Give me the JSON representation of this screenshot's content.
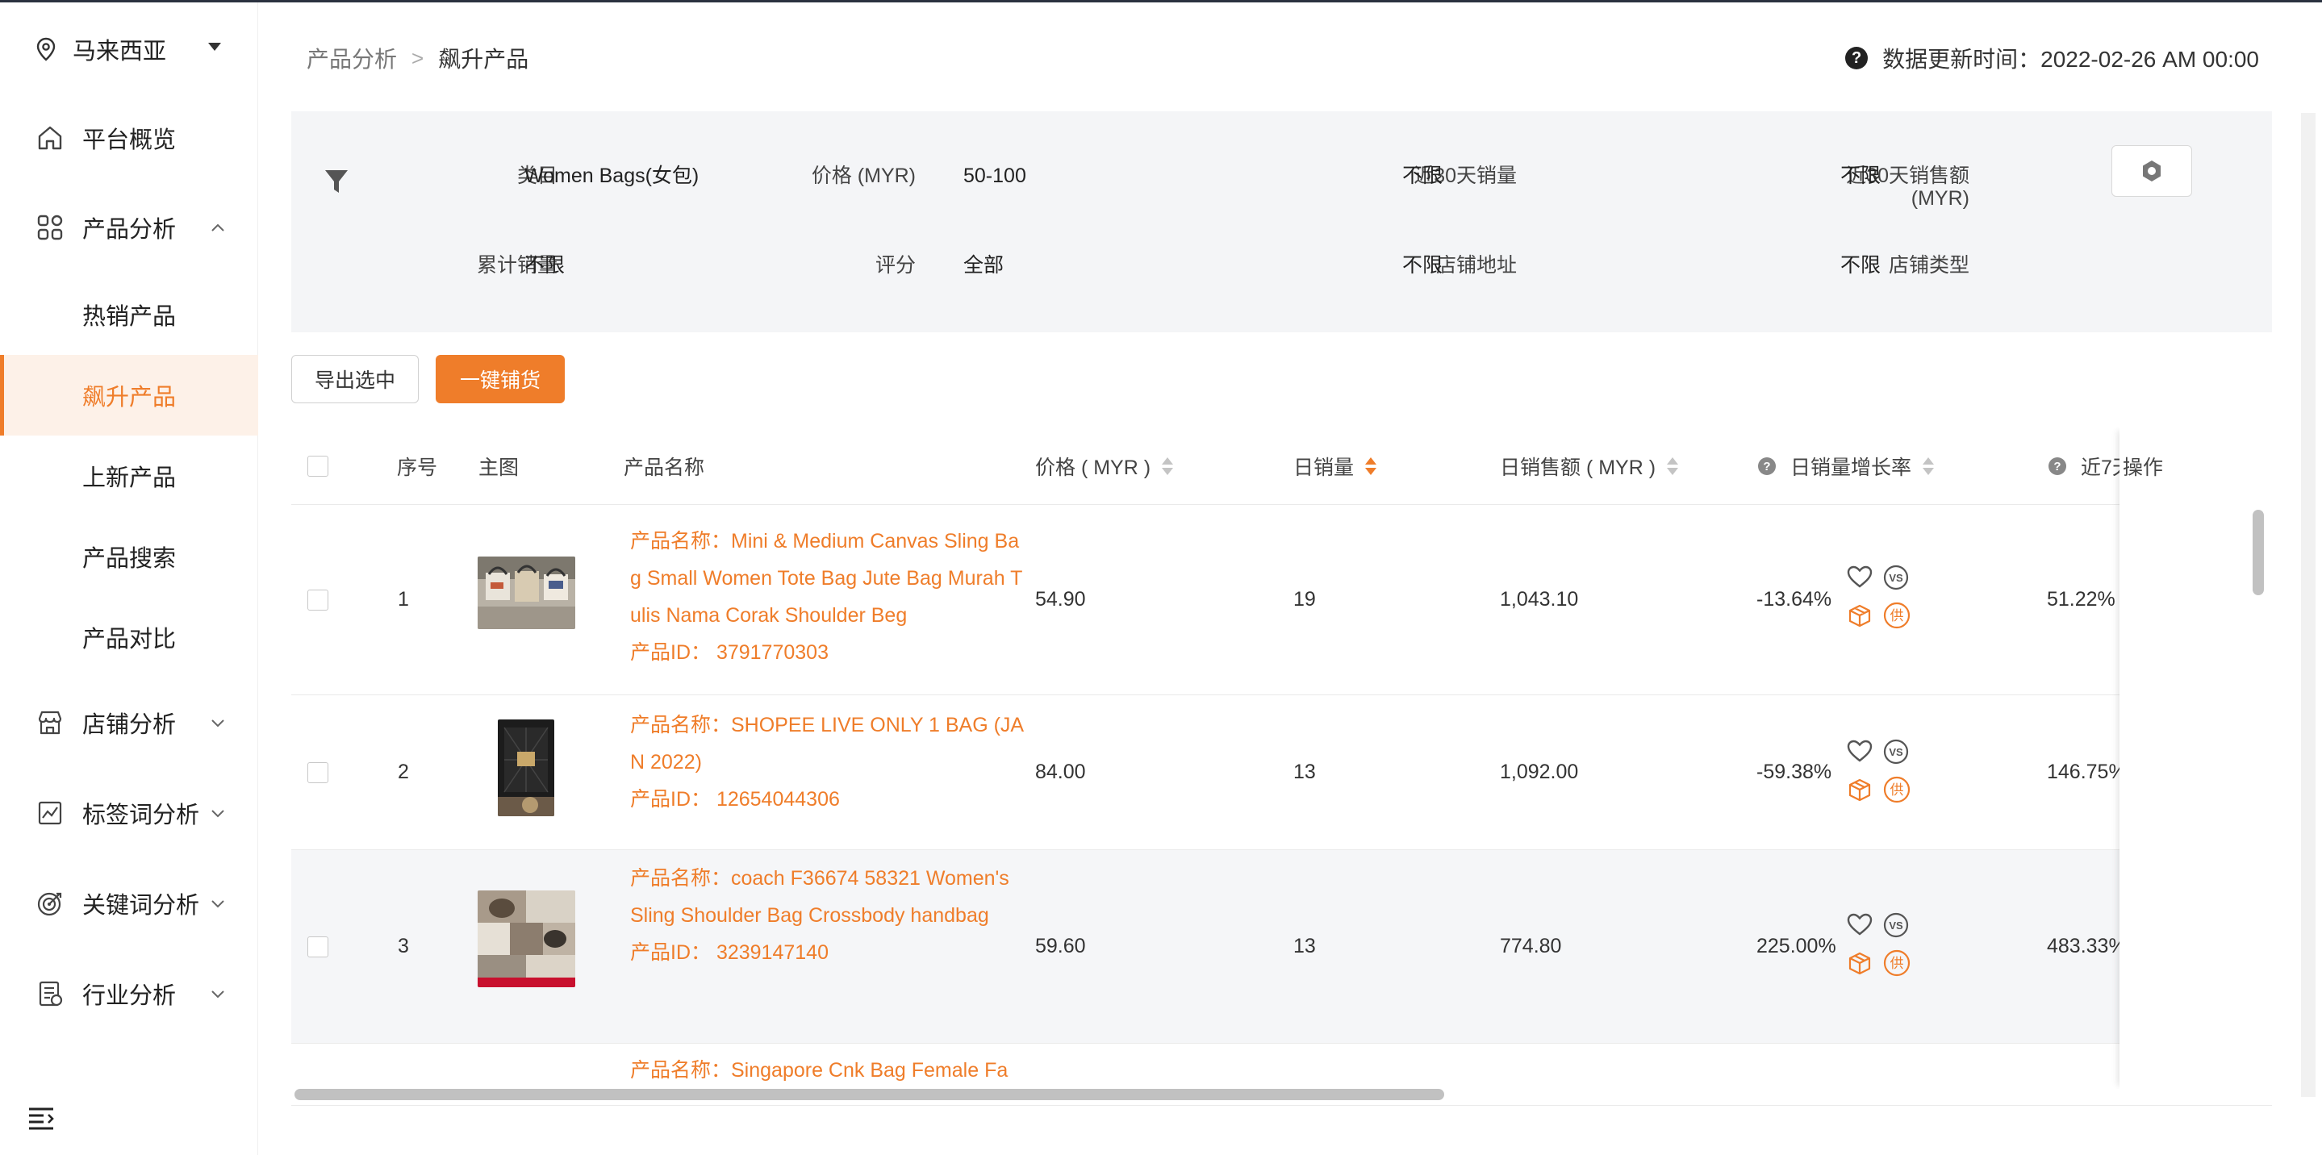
{
  "location": {
    "label": "马来西亚"
  },
  "sidebar": {
    "items": [
      {
        "label": "平台概览"
      },
      {
        "label": "产品分析"
      },
      {
        "label": "店铺分析"
      },
      {
        "label": "标签词分析"
      },
      {
        "label": "关键词分析"
      },
      {
        "label": "行业分析"
      }
    ],
    "sub_items": [
      {
        "label": "热销产品"
      },
      {
        "label": "飙升产品"
      },
      {
        "label": "上新产品"
      },
      {
        "label": "产品搜索"
      },
      {
        "label": "产品对比"
      }
    ]
  },
  "breadcrumb": {
    "parent": "产品分析",
    "separator": ">",
    "current": "飙升产品"
  },
  "update_time": {
    "label": "数据更新时间：2022-02-26 AM 00:00"
  },
  "filters": {
    "category": {
      "label": "类目",
      "value": "Women Bags(女包)"
    },
    "price": {
      "label": "价格 (MYR)",
      "value": "50-100"
    },
    "sales30": {
      "label": "近30天销量",
      "value": "不限"
    },
    "revenue30": {
      "label": "近30天销售额",
      "label2": "(MYR)",
      "value": "不限"
    },
    "total_sales": {
      "label": "累计销量",
      "value": "不限"
    },
    "rating": {
      "label": "评分",
      "value": "全部"
    },
    "shop_location": {
      "label": "店铺地址",
      "value": "不限"
    },
    "shop_type": {
      "label": "店铺类型",
      "value": "不限"
    }
  },
  "actions": {
    "export_label": "导出选中",
    "stock_label": "一键铺货"
  },
  "table": {
    "headers": {
      "index": "序号",
      "image": "主图",
      "name": "产品名称",
      "price": "价格 ( MYR )",
      "daily_sales": "日销量",
      "daily_revenue": "日销售额 ( MYR )",
      "growth": "日销量增长率",
      "growth7": "近7天",
      "ops": "操作"
    },
    "rows": [
      {
        "index": "1",
        "name_line": "产品名称：Mini & Medium Canvas Sling Bag Small Women Tote Bag Jute Bag Murah Tulis Nama Corak Shoulder Beg",
        "id_line": "产品ID：  3791770303",
        "price": "54.90",
        "daily_sales": "19",
        "daily_revenue": "1,043.10",
        "growth": "-13.64%",
        "growth7": "51.22%"
      },
      {
        "index": "2",
        "name_line": "产品名称：SHOPEE LIVE ONLY 1 BAG (JAN 2022)",
        "id_line": "产品ID：  12654044306",
        "price": "84.00",
        "daily_sales": "13",
        "daily_revenue": "1,092.00",
        "growth": "-59.38%",
        "growth7": "146.75%"
      },
      {
        "index": "3",
        "name_line": "产品名称：coach F36674 58321 Women's Sling Shoulder Bag Crossbody handbag",
        "id_line": "产品ID：  3239147140",
        "price": "59.60",
        "daily_sales": "13",
        "daily_revenue": "774.80",
        "growth": "225.00%",
        "growth7": "483.33%"
      },
      {
        "index": "",
        "name_line": "产品名称：Singapore Cnk Bag Female Fa",
        "id_line": "",
        "price": "",
        "daily_sales": "",
        "daily_revenue": "",
        "growth": "",
        "growth7": ""
      }
    ]
  },
  "ops": {
    "supply_glyph": "供",
    "vs_glyph": "VS"
  },
  "colors": {
    "accent": "#ef7d2a",
    "panel": "#f4f5f7"
  },
  "icons": [
    "location-pin-icon",
    "home-icon",
    "grid-icon",
    "shop-icon",
    "chart-icon",
    "target-icon",
    "industry-icon",
    "filter-icon",
    "settings-icon",
    "heart-icon",
    "vs-icon",
    "box-icon",
    "supply-icon",
    "menu-toggle-icon"
  ]
}
